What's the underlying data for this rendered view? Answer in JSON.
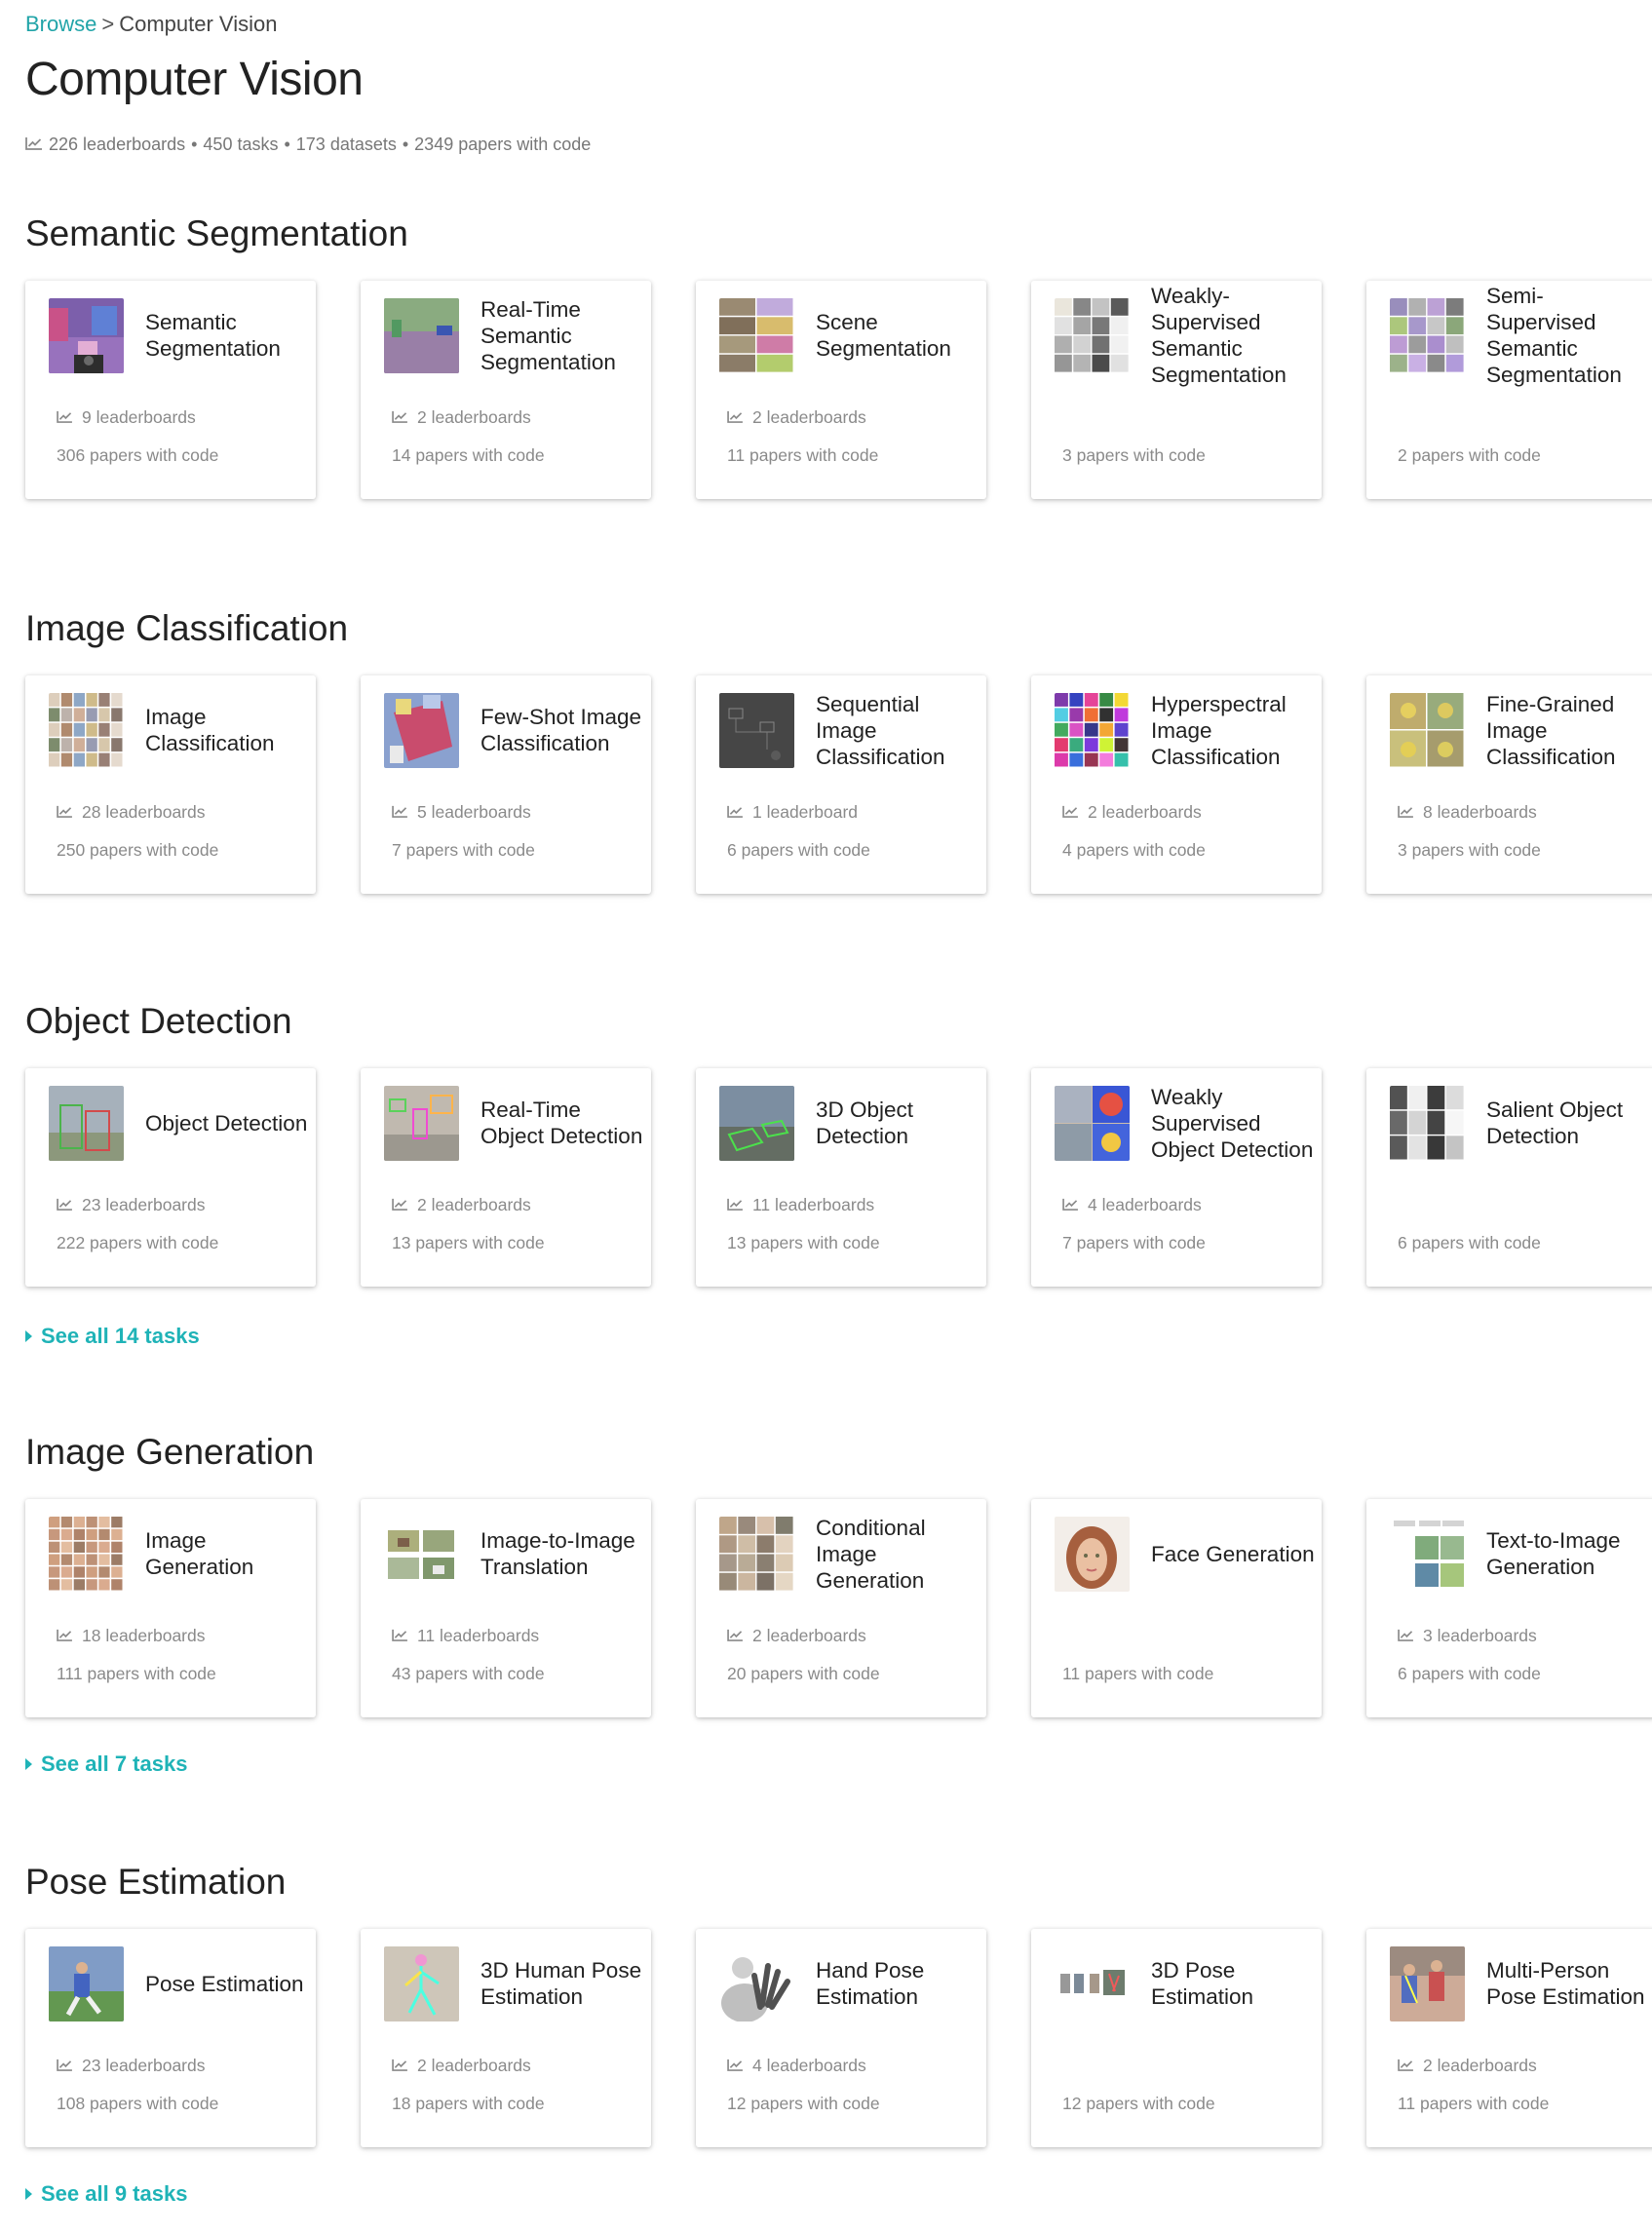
{
  "breadcrumb": {
    "root": "Browse",
    "separator": ">",
    "current": "Computer Vision"
  },
  "title": "Computer Vision",
  "stats": {
    "leaderboards": "226 leaderboards",
    "tasks": "450 tasks",
    "datasets": "173 datasets",
    "papers": "2349 papers with code",
    "separator": "•"
  },
  "colors": {
    "accent": "#21a4a8",
    "see_all": "#1fb3b7",
    "muted_text": "#8a8a8a"
  },
  "sections": [
    {
      "title": "Semantic Segmentation",
      "cards": [
        {
          "title": "Semantic Segmentation",
          "leaderboards": "9 leaderboards",
          "papers": "306 papers with code",
          "thumb": "seg"
        },
        {
          "title": "Real-Time Semantic Segmentation",
          "leaderboards": "2 leaderboards",
          "papers": "14 papers with code",
          "thumb": "street"
        },
        {
          "title": "Scene Segmentation",
          "leaderboards": "2 leaderboards",
          "papers": "11 papers with code",
          "thumb": "scene"
        },
        {
          "title": "Weakly-Supervised Semantic Segmentation",
          "leaderboards": "",
          "papers": "3 papers with code",
          "thumb": "weak"
        },
        {
          "title": "Semi-Supervised Semantic Segmentation",
          "leaderboards": "",
          "papers": "2 papers with code",
          "thumb": "semi"
        }
      ]
    },
    {
      "title": "Image Classification",
      "cards": [
        {
          "title": "Image Classification",
          "leaderboards": "28 leaderboards",
          "papers": "250 papers with code",
          "thumb": "imgcls"
        },
        {
          "title": "Few-Shot Image Classification",
          "leaderboards": "5 leaderboards",
          "papers": "7 papers with code",
          "thumb": "fewshot"
        },
        {
          "title": "Sequential Image Classification",
          "leaderboards": "1 leaderboard",
          "papers": "6 papers with code",
          "thumb": "seqimg"
        },
        {
          "title": "Hyperspectral Image Classification",
          "leaderboards": "2 leaderboards",
          "papers": "4 papers with code",
          "thumb": "hyper"
        },
        {
          "title": "Fine-Grained Image Classification",
          "leaderboards": "8 leaderboards",
          "papers": "3 papers with code",
          "thumb": "birds"
        }
      ]
    },
    {
      "title": "Object Detection",
      "see_all": "See all 14 tasks",
      "cards": [
        {
          "title": "Object Detection",
          "leaderboards": "23 leaderboards",
          "papers": "222 papers with code",
          "thumb": "objdet"
        },
        {
          "title": "Real-Time Object Detection",
          "leaderboards": "2 leaderboards",
          "papers": "13 papers with code",
          "thumb": "rtdet"
        },
        {
          "title": "3D Object Detection",
          "leaderboards": "11 leaderboards",
          "papers": "13 papers with code",
          "thumb": "det3d"
        },
        {
          "title": "Weakly Supervised Object Detection",
          "leaderboards": "4 leaderboards",
          "papers": "7 papers with code",
          "thumb": "heat"
        },
        {
          "title": "Salient Object Detection",
          "leaderboards": "",
          "papers": "6 papers with code",
          "thumb": "salient"
        }
      ]
    },
    {
      "title": "Image Generation",
      "see_all": "See all 7 tasks",
      "cards": [
        {
          "title": "Image Generation",
          "leaderboards": "18 leaderboards",
          "papers": "111 papers with code",
          "thumb": "faces"
        },
        {
          "title": "Image-to-Image Translation",
          "leaderboards": "11 leaderboards",
          "papers": "43 papers with code",
          "thumb": "horses"
        },
        {
          "title": "Conditional Image Generation",
          "leaderboards": "2 leaderboards",
          "papers": "20 papers with code",
          "thumb": "condgen"
        },
        {
          "title": "Face Generation",
          "leaderboards": "",
          "papers": "11 papers with code",
          "thumb": "face"
        },
        {
          "title": "Text-to-Image Generation",
          "leaderboards": "3 leaderboards",
          "papers": "6 papers with code",
          "thumb": "t2i"
        }
      ]
    },
    {
      "title": "Pose Estimation",
      "see_all": "See all 9 tasks",
      "cards": [
        {
          "title": "Pose Estimation",
          "leaderboards": "23 leaderboards",
          "papers": "108 papers with code",
          "thumb": "soccer"
        },
        {
          "title": "3D Human Pose Estimation",
          "leaderboards": "2 leaderboards",
          "papers": "18 papers with code",
          "thumb": "skeleton"
        },
        {
          "title": "Hand Pose Estimation",
          "leaderboards": "4 leaderboards",
          "papers": "12 papers with code",
          "thumb": "hand"
        },
        {
          "title": "3D Pose Estimation",
          "leaderboards": "",
          "papers": "12 papers with code",
          "thumb": "pose3d"
        },
        {
          "title": "Multi-Person Pose Estimation",
          "leaderboards": "2 leaderboards",
          "papers": "11 papers with code",
          "thumb": "multi"
        }
      ]
    }
  ]
}
